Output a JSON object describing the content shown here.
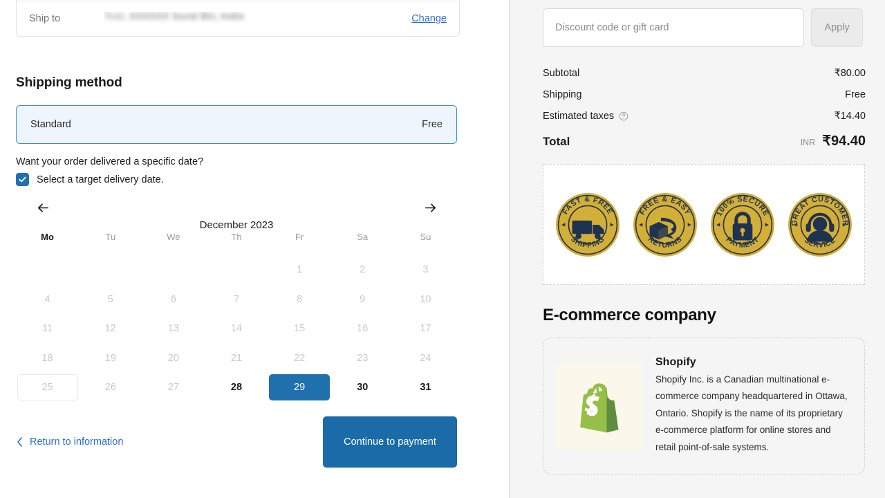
{
  "shipping_address": {
    "label": "Ship to",
    "value_visible": "Test,",
    "value_redacted": "XXXXXX Surat BU, India",
    "change_label": "Change"
  },
  "shipping_method": {
    "title": "Shipping method",
    "option_name": "Standard",
    "option_price": "Free"
  },
  "delivery_date": {
    "question": "Want your order delivered a specific date?",
    "checkbox_label": "Select a target delivery date.",
    "checkbox_checked": true,
    "prev_icon": "arrow-left-icon",
    "next_icon": "arrow-right-icon",
    "month_title": "December 2023",
    "day_headers": [
      "Mo",
      "Tu",
      "We",
      "Th",
      "Fr",
      "Sa",
      "Su"
    ],
    "active_day_header": "Mo",
    "weeks": [
      [
        {
          "label": "",
          "state": "empty"
        },
        {
          "label": "",
          "state": "empty"
        },
        {
          "label": "",
          "state": "empty"
        },
        {
          "label": "",
          "state": "empty"
        },
        {
          "label": "1",
          "state": "disabled"
        },
        {
          "label": "2",
          "state": "disabled"
        },
        {
          "label": "3",
          "state": "disabled"
        }
      ],
      [
        {
          "label": "4",
          "state": "disabled"
        },
        {
          "label": "5",
          "state": "disabled"
        },
        {
          "label": "6",
          "state": "disabled"
        },
        {
          "label": "7",
          "state": "disabled"
        },
        {
          "label": "8",
          "state": "disabled"
        },
        {
          "label": "9",
          "state": "disabled"
        },
        {
          "label": "10",
          "state": "disabled"
        }
      ],
      [
        {
          "label": "11",
          "state": "disabled"
        },
        {
          "label": "12",
          "state": "disabled"
        },
        {
          "label": "13",
          "state": "disabled"
        },
        {
          "label": "14",
          "state": "disabled"
        },
        {
          "label": "15",
          "state": "disabled"
        },
        {
          "label": "16",
          "state": "disabled"
        },
        {
          "label": "17",
          "state": "disabled"
        }
      ],
      [
        {
          "label": "18",
          "state": "disabled"
        },
        {
          "label": "19",
          "state": "disabled"
        },
        {
          "label": "20",
          "state": "disabled"
        },
        {
          "label": "21",
          "state": "disabled"
        },
        {
          "label": "22",
          "state": "disabled"
        },
        {
          "label": "23",
          "state": "disabled"
        },
        {
          "label": "24",
          "state": "disabled"
        }
      ],
      [
        {
          "label": "25",
          "state": "today"
        },
        {
          "label": "26",
          "state": "disabled"
        },
        {
          "label": "27",
          "state": "disabled"
        },
        {
          "label": "28",
          "state": "avail"
        },
        {
          "label": "29",
          "state": "selected"
        },
        {
          "label": "30",
          "state": "avail"
        },
        {
          "label": "31",
          "state": "avail"
        }
      ]
    ],
    "selected_date": "29"
  },
  "actions": {
    "back_icon": "chevron-left-icon",
    "back_label": "Return to information",
    "continue_label": "Continue to payment"
  },
  "order_summary": {
    "discount_placeholder": "Discount code or gift card",
    "discount_value": "",
    "apply_label": "Apply",
    "rows": [
      {
        "label": "Subtotal",
        "value": "₹80.00",
        "has_help": false
      },
      {
        "label": "Shipping",
        "value": "Free",
        "has_help": false
      },
      {
        "label": "Estimated taxes",
        "value": "₹14.40",
        "has_help": true
      }
    ],
    "total_label": "Total",
    "total_currency": "INR",
    "total_value": "₹94.40"
  },
  "trust_badges": [
    {
      "icon": "truck-icon",
      "top_text": "FAST & FREE",
      "bottom_text": "SHIPPING"
    },
    {
      "icon": "return-box-icon",
      "top_text": "FREE & EASY",
      "bottom_text": "RETURNS"
    },
    {
      "icon": "lock-icon",
      "top_text": "100% SECURE",
      "bottom_text": "PAYMENT"
    },
    {
      "icon": "headset-agent-icon",
      "top_text": "GREAT CUSTOMER",
      "bottom_text": "SERVICE"
    }
  ],
  "ecommerce": {
    "heading": "E-commerce company",
    "logo_icon": "shopify-bag-icon",
    "name": "Shopify",
    "description": "Shopify Inc. is a Canadian multinational e-commerce company headquartered in Ottawa, Ontario. Shopify is the name of its proprietary e-commerce platform for online stores and retail point-of-sale systems."
  },
  "colors": {
    "accent_blue": "#2170ae",
    "link_blue": "#2c6ecb",
    "button_blue": "#1a6ba8",
    "option_bg": "#eff5fc",
    "option_border": "#3c8ed0",
    "sidebar_bg": "#f5f5f5",
    "badge_gold": "#d4af37",
    "badge_navy": "#1f3350",
    "shopify_green": "#95bf47"
  }
}
